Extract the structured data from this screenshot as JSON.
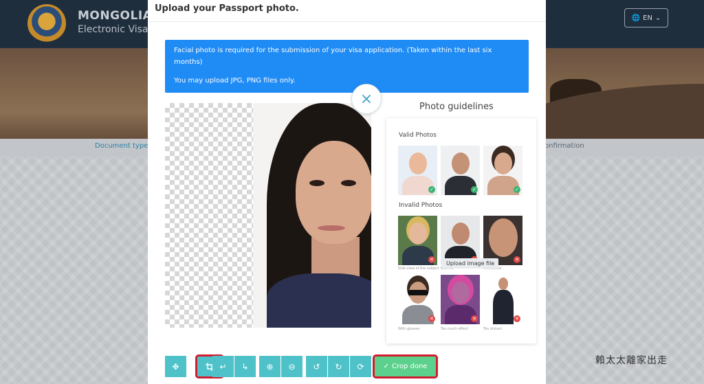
{
  "site": {
    "title": "MONGOLIA",
    "subtitle": "Electronic Visa",
    "language": "EN",
    "steps": {
      "left": "Document type",
      "right": "onfirmation"
    }
  },
  "modal": {
    "title": "Upload your Passport photo.",
    "info_line1": "Facial photo is required for the submission of your visa application. (Taken within the last six months)",
    "info_line2": "You may upload JPG, PNG files only."
  },
  "guidelines": {
    "heading": "Photo guidelines",
    "valid_label": "Valid Photos",
    "invalid_label": "Invalid Photos",
    "tooltip": "Upload image file",
    "invalid_captions": [
      "Side view of the subject",
      "Blurred",
      "Distracted",
      "With glasses",
      "Too much effect",
      "Too distant"
    ]
  },
  "toolbar": {
    "crop_done": "Crop done"
  },
  "watermark": "賴太太離家出走",
  "colors": {
    "teal": "#4fc2c9",
    "green": "#5cd18d",
    "blue": "#1f8bf5",
    "highlight": "#d11c2f"
  }
}
